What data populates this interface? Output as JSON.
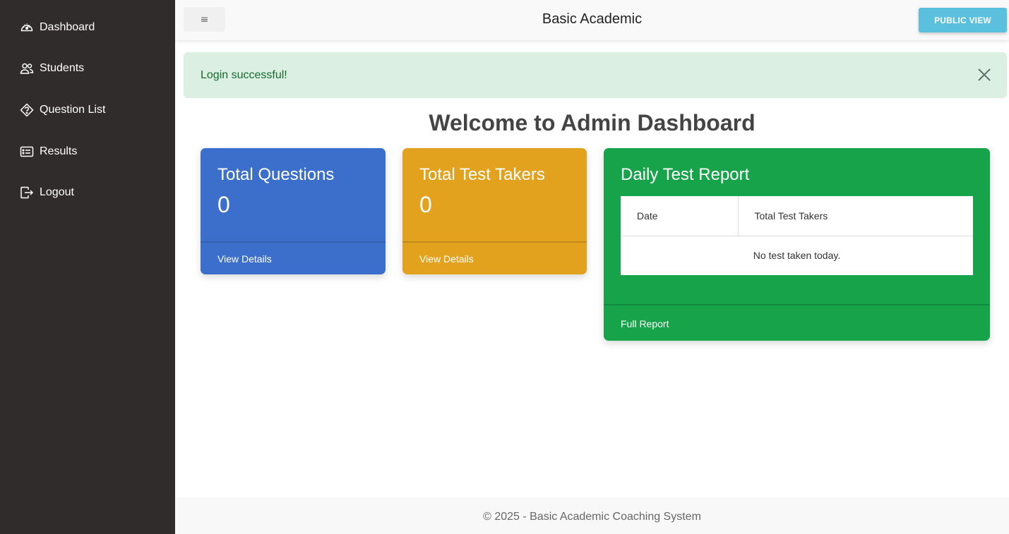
{
  "sidebar": {
    "items": [
      {
        "label": "Dashboard",
        "icon": "gauge-icon"
      },
      {
        "label": "Students",
        "icon": "users-icon"
      },
      {
        "label": "Question List",
        "icon": "question-diamond-icon"
      },
      {
        "label": "Results",
        "icon": "card-list-icon"
      },
      {
        "label": "Logout",
        "icon": "box-arrow-right-icon"
      }
    ]
  },
  "topbar": {
    "toggle_label": "≡",
    "brand": "Basic Academic",
    "public_view_label": "PUBLIC VIEW"
  },
  "alert": {
    "message": "Login successful!",
    "close_icon": "close-icon"
  },
  "main": {
    "heading": "Welcome to Admin Dashboard",
    "cards": [
      {
        "title": "Total Questions",
        "value": "0",
        "link": "View Details",
        "color": "#3b6fcb"
      },
      {
        "title": "Total Test Takers",
        "value": "0",
        "link": "View Details",
        "color": "#e3a21e"
      }
    ],
    "report": {
      "title": "Daily Test Report",
      "columns": [
        "Date",
        "Total Test Takers"
      ],
      "empty_message": "No test taken today.",
      "link": "Full Report",
      "color": "#17a34a"
    }
  },
  "footer": {
    "text": "© 2025 - Basic Academic Coaching System"
  },
  "colors": {
    "sidebar_bg": "#312c2c",
    "public_view_button": "#5bc0de",
    "alert_bg": "#dcefe3",
    "alert_text": "#146a2f"
  }
}
